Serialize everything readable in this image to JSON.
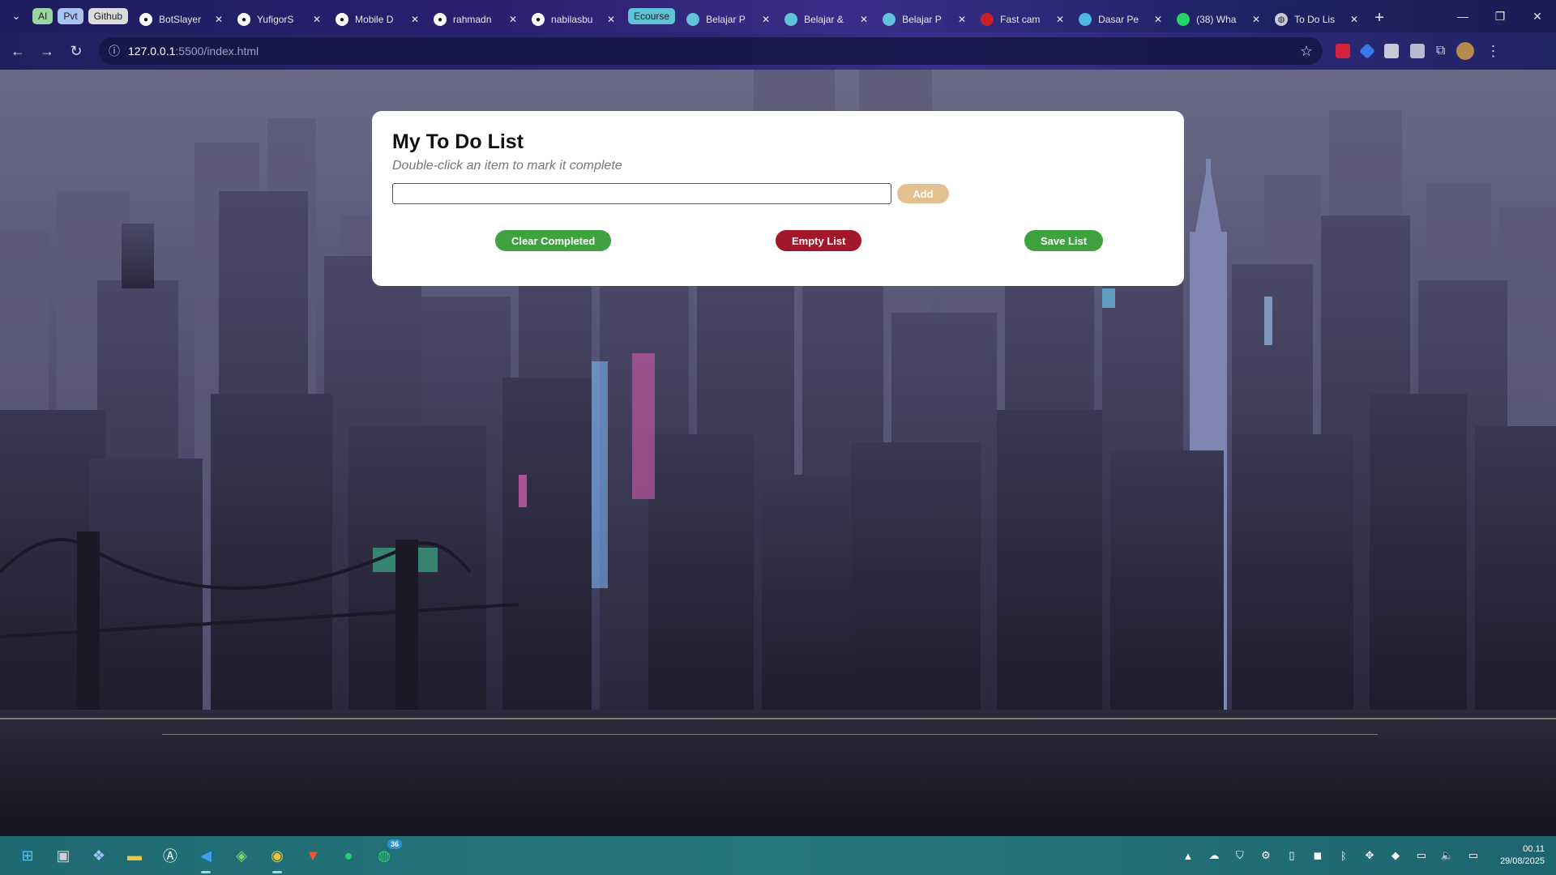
{
  "browser": {
    "tab_groups": [
      {
        "label": "AI",
        "color": "#9ad6a0"
      },
      {
        "label": "Pvt",
        "color": "#a9c3f5"
      },
      {
        "label": "Github",
        "color": "#dcdcdc"
      }
    ],
    "tabs": [
      {
        "label": "BotSlayer",
        "icon": "github-icon",
        "group_color": "#dcdcdc"
      },
      {
        "label": "YufigorS",
        "icon": "github-icon",
        "group_color": "#dcdcdc"
      },
      {
        "label": "Mobile D",
        "icon": "github-icon",
        "group_color": "#dcdcdc"
      },
      {
        "label": "rahmadn",
        "icon": "github-icon",
        "group_color": "#dcdcdc"
      },
      {
        "label": "nabilasbu",
        "icon": "github-icon",
        "group_color": "#dcdcdc"
      },
      {
        "label": "Belajar P",
        "icon": "dicoding-icon",
        "group_color": "#5ec3d6"
      },
      {
        "label": "Belajar &",
        "icon": "dicoding-icon",
        "group_color": "#5ec3d6"
      },
      {
        "label": "Belajar P",
        "icon": "dicoding-icon",
        "group_color": "#5ec3d6"
      },
      {
        "label": "Fast cam",
        "icon": "bitdefender-icon",
        "group_color": ""
      },
      {
        "label": "Dasar Pe",
        "icon": "codepolitan-icon",
        "group_color": ""
      },
      {
        "label": "(38) Wha",
        "icon": "whatsapp-icon",
        "group_color": ""
      },
      {
        "label": "To Do Lis",
        "icon": "globe-icon",
        "group_color": "",
        "active": true
      }
    ],
    "ecourse_group": {
      "label": "Ecourse",
      "color": "#5ec3d6"
    },
    "new_tab_label": "+",
    "url_host": "127.0.0.1",
    "url_path": ":5500/index.html"
  },
  "todo": {
    "title": "My To Do List",
    "subtitle": "Double-click an item to mark it complete",
    "input_value": "",
    "add_label": "Add",
    "clear_label": "Clear Completed",
    "empty_label": "Empty List",
    "save_label": "Save List"
  },
  "taskbar": {
    "whatsapp_badge": "36",
    "time": "00.11",
    "date": "29/08/2025"
  },
  "colors": {
    "accent_green": "#3fa140",
    "danger_red": "#a3172c",
    "add_tan": "#e2c08f"
  }
}
